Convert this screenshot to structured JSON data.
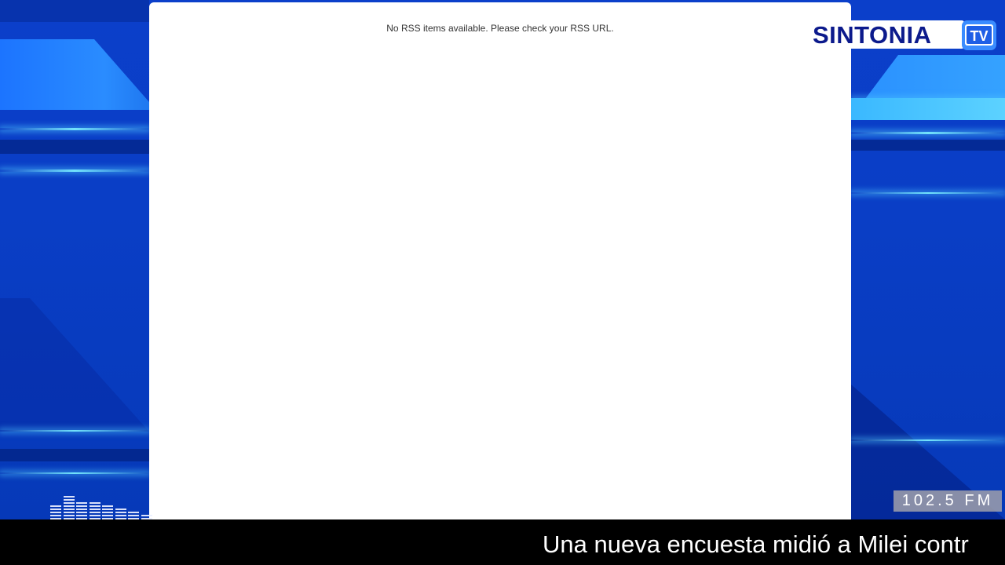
{
  "rss": {
    "message": "No RSS items available. Please check your RSS URL."
  },
  "logo": {
    "name": "SINTONIA",
    "badge": "TV",
    "icon": "tv-icon"
  },
  "equalizer": {
    "icon": "audio-equalizer-icon",
    "levels": [
      0.45,
      0.75,
      0.6,
      0.55,
      0.45,
      0.4,
      0.35,
      0.25
    ]
  },
  "station": {
    "frequency": "102.5 FM"
  },
  "ticker": {
    "text": "Una nueva encuesta midió a Milei contr"
  },
  "colors": {
    "background_blue": "#0a3ec6",
    "accent_cyan": "#5adcff",
    "logo_navy": "#0c1a8c",
    "ticker_bg": "#000000",
    "panel_bg": "#ffffff"
  }
}
